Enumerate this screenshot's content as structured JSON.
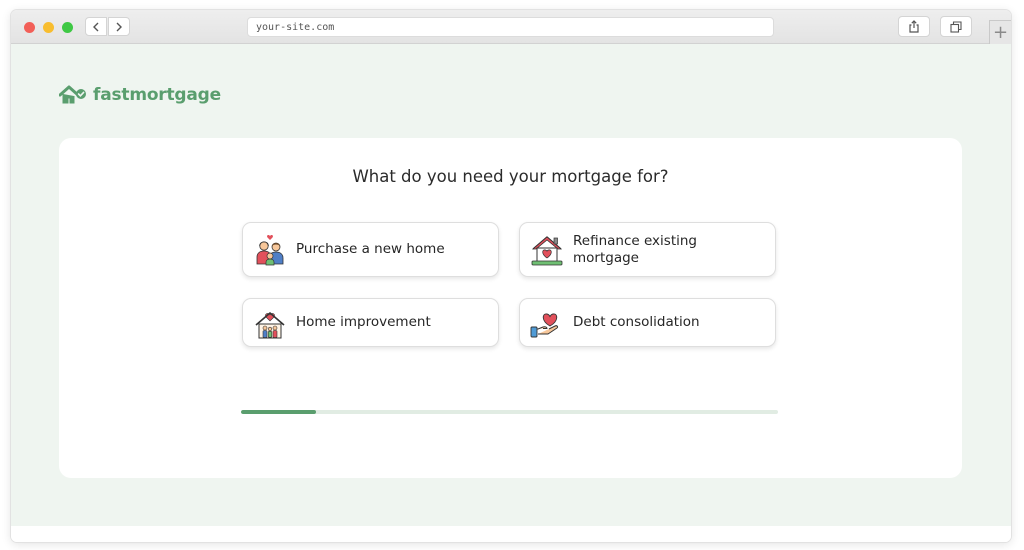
{
  "browser": {
    "url": "your-site.com"
  },
  "brand": {
    "name": "fastmortgage",
    "color": "#5a9e6e"
  },
  "form": {
    "question": "What do you need your mortgage for?",
    "options": [
      {
        "label": "Purchase a new home",
        "icon": "family-icon"
      },
      {
        "label": "Refinance existing mortgage",
        "icon": "house-heart-icon"
      },
      {
        "label": "Home improvement",
        "icon": "home-family-icon"
      },
      {
        "label": "Debt consolidation",
        "icon": "hand-heart-icon"
      }
    ],
    "progress_fraction": 0.14
  }
}
